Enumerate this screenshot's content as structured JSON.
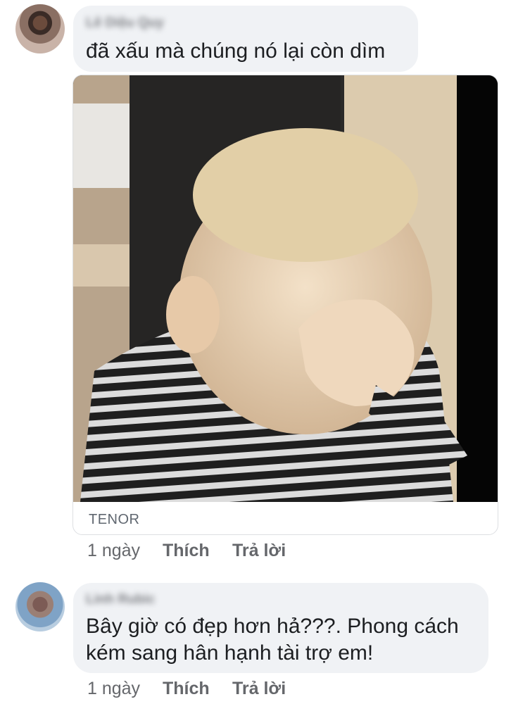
{
  "comments": [
    {
      "author": "Lê Diệu Quy",
      "text": "đã xấu mà chúng nó lại còn dìm",
      "attachment": {
        "type": "gif",
        "source": "TENOR"
      },
      "time": "1 ngày",
      "like_label": "Thích",
      "reply_label": "Trả lời"
    },
    {
      "author": "Linh Rubic",
      "text": "Bây giờ có đẹp hơn hả???. Phong cách kém sang hân hạnh tài trợ em!",
      "time": "1 ngày",
      "like_label": "Thích",
      "reply_label": "Trả lời"
    }
  ]
}
